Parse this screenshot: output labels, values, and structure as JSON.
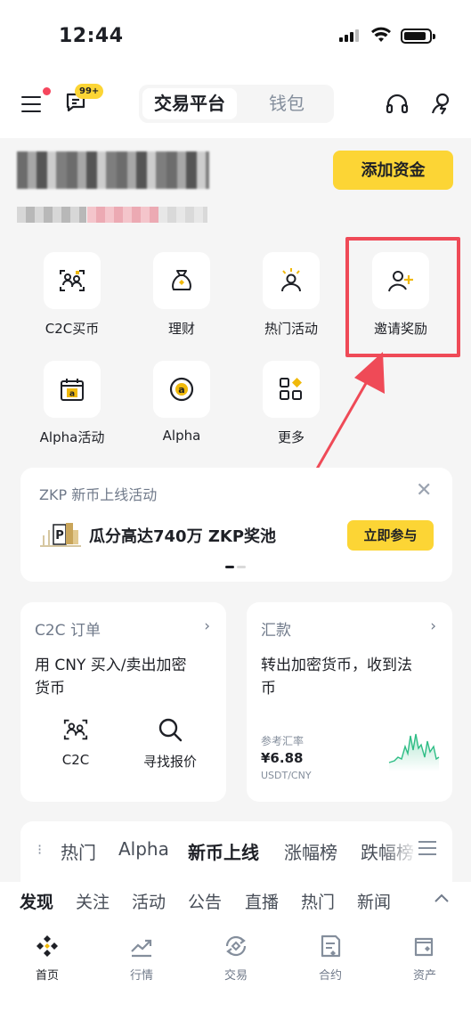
{
  "status_bar": {
    "time": "12:44"
  },
  "header": {
    "badge": "99+",
    "tabs": [
      "交易平台",
      "钱包"
    ]
  },
  "account": {
    "add_funds": "添加资金"
  },
  "shortcuts": [
    {
      "label": "C2C买币",
      "icon": "c2c-users-icon"
    },
    {
      "label": "理财",
      "icon": "money-bag-icon"
    },
    {
      "label": "热门活动",
      "icon": "event-person-icon"
    },
    {
      "label": "邀请奖励",
      "icon": "invite-user-icon"
    },
    {
      "label": "Alpha活动",
      "icon": "alpha-calendar-icon"
    },
    {
      "label": "Alpha",
      "icon": "alpha-icon"
    },
    {
      "label": "更多",
      "icon": "grid-more-icon"
    }
  ],
  "banner": {
    "title": "ZKP 新币上线活动",
    "text": "瓜分高达740万 ZKP奖池",
    "button": "立即参与"
  },
  "c2c_card": {
    "title": "C2C 订单",
    "desc_line1": "用 CNY 买入/卖出加密",
    "desc_line2": "货币",
    "items": [
      "C2C",
      "寻找报价"
    ]
  },
  "remit_card": {
    "title": "汇款",
    "desc_line1": "转出加密货币，收到法",
    "desc_line2": "币",
    "rate_label": "参考汇率",
    "rate_value": "¥6.88",
    "rate_pair": "USDT/CNY"
  },
  "market_tabs": {
    "tabs": [
      "热门",
      "Alpha",
      "新币上线",
      "涨幅榜",
      "跌幅榜"
    ],
    "active": "新币上线"
  },
  "feed_tabs": {
    "tabs": [
      "发现",
      "关注",
      "活动",
      "公告",
      "直播",
      "热门",
      "新闻"
    ],
    "active": "发现"
  },
  "bottom_nav": [
    {
      "label": "首页",
      "icon": "home-binance-icon"
    },
    {
      "label": "行情",
      "icon": "market-chart-icon"
    },
    {
      "label": "交易",
      "icon": "trade-icon"
    },
    {
      "label": "合约",
      "icon": "futures-icon"
    },
    {
      "label": "资产",
      "icon": "wallet-icon"
    }
  ],
  "colors": {
    "accent": "#fcd535",
    "highlight": "#ef4a57",
    "positive": "#2ebd85",
    "background": "#f5f5f5"
  }
}
